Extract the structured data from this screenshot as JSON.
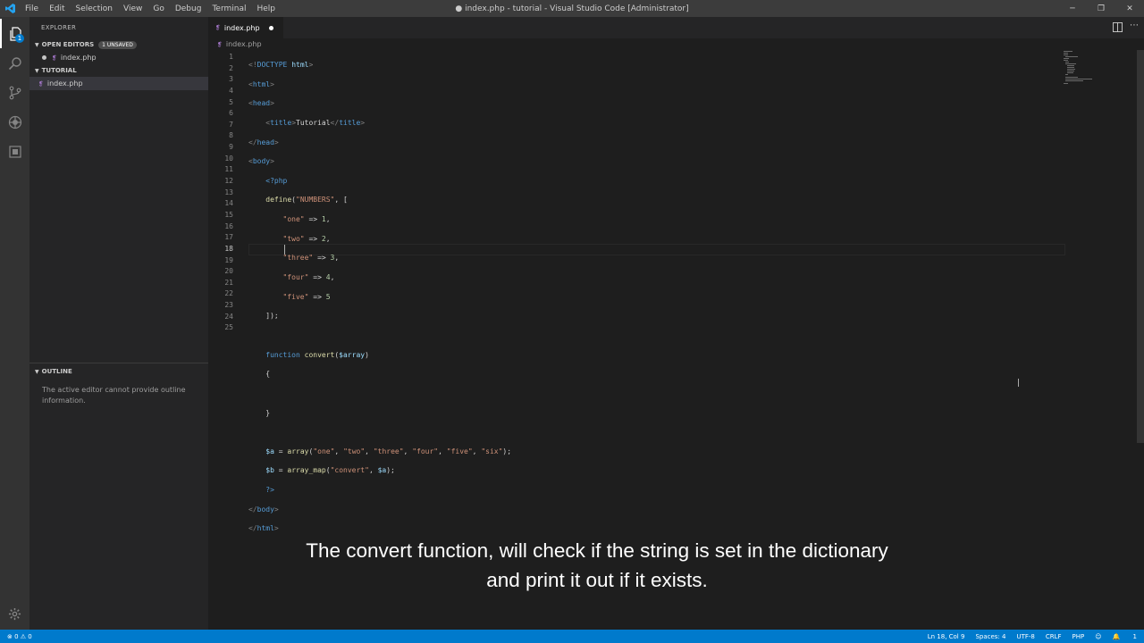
{
  "window": {
    "title": "● index.php - tutorial - Visual Studio Code [Administrator]",
    "controls": [
      "─",
      "❐",
      "✕"
    ]
  },
  "menu": [
    "File",
    "Edit",
    "Selection",
    "View",
    "Go",
    "Debug",
    "Terminal",
    "Help"
  ],
  "sidebar": {
    "title": "EXPLORER",
    "open_editors": {
      "label": "OPEN EDITORS",
      "badge": "1 UNSAVED",
      "file": "index.php"
    },
    "folder": {
      "label": "TUTORIAL",
      "file": "index.php"
    },
    "outline": {
      "label": "OUTLINE",
      "message": "The active editor cannot provide outline information."
    }
  },
  "activity_badge": "1",
  "tab": {
    "label": "index.php"
  },
  "breadcrumb": "index.php",
  "editor": {
    "current_line": 18,
    "line_numbers": [
      "1",
      "2",
      "3",
      "4",
      "5",
      "6",
      "7",
      "8",
      "9",
      "10",
      "11",
      "12",
      "13",
      "14",
      "15",
      "16",
      "17",
      "18",
      "19",
      "20",
      "21",
      "22",
      "23",
      "24",
      "25"
    ]
  },
  "subtitle": {
    "line1": "The convert function, will check if the string is set in the dictionary",
    "line2": "and print it out if it exists."
  },
  "status": {
    "errors": "0",
    "warnings": "0",
    "position": "Ln 18, Col 9",
    "spaces": "Spaces: 4",
    "encoding": "UTF-8",
    "eol": "CRLF",
    "language": "PHP",
    "notifications": "1"
  },
  "colors": {
    "accent": "#007acc",
    "sidebar": "#252526",
    "editor": "#1e1e1e",
    "php_icon": "#a074c4"
  }
}
